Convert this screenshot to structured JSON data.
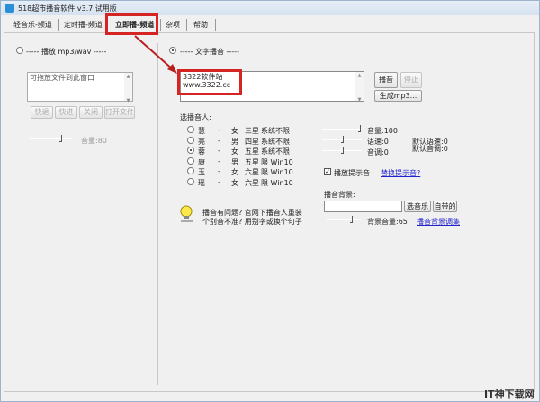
{
  "window": {
    "title": "518超市播音软件 v3.7 试用版"
  },
  "tabs": [
    {
      "label": "轻音乐-频道"
    },
    {
      "label": "定时播-频道"
    },
    {
      "label": "立即播-频道"
    },
    {
      "label": "杂项"
    },
    {
      "label": "帮助"
    }
  ],
  "left": {
    "radio_label": "----- 播放 mp3/wav -----",
    "drop_text": "可拖放文件到此窗口",
    "buttons": [
      "快退",
      "快进",
      "关闭",
      "打开文件"
    ],
    "volume": "音量:80",
    "volume_value": 80
  },
  "right": {
    "radio_label": "----- 文字播音 -----",
    "text_value": "3322软件站\nwww.3322.cc",
    "play": "播音",
    "stop": "停止",
    "make_mp3": "生成mp3...",
    "voice_title": "选播音人:",
    "voices": [
      {
        "name": "慧",
        "gender": "女",
        "stars": "三星",
        "req": "系统不限",
        "selected": false
      },
      {
        "name": "亮",
        "gender": "男",
        "stars": "四星",
        "req": "系统不限",
        "selected": false
      },
      {
        "name": "蓉",
        "gender": "女",
        "stars": "五星",
        "req": "系统不限",
        "selected": true
      },
      {
        "name": "康",
        "gender": "男",
        "stars": "五星",
        "req": "限 Win10",
        "selected": false
      },
      {
        "name": "玉",
        "gender": "女",
        "stars": "六星",
        "req": "限 Win10",
        "selected": false
      },
      {
        "name": "瑶",
        "gender": "女",
        "stars": "六星",
        "req": "限 Win10",
        "selected": false
      }
    ],
    "dash": "-",
    "volume": "音量:100",
    "speed": "语速:0",
    "pitch": "音调:0",
    "default_speed": "默认语速:0",
    "default_pitch": "默认音调:0",
    "play_prompt": "播放提示音",
    "replace_prompt": "替换提示音?",
    "bg_title": "播音背景:",
    "bg_input": "",
    "choose_music": "选音乐",
    "builtin": "自带的",
    "bg_volume": "背景音量:65",
    "bg_link": "播音背景调集",
    "tip_line1": "播音有问题? 官网下播音人重装",
    "tip_line2": "个别音不准? 用别字或换个句子"
  },
  "watermark": "IT神下载网",
  "colors": {
    "highlight": "#d42424",
    "link": "#2222cc"
  }
}
